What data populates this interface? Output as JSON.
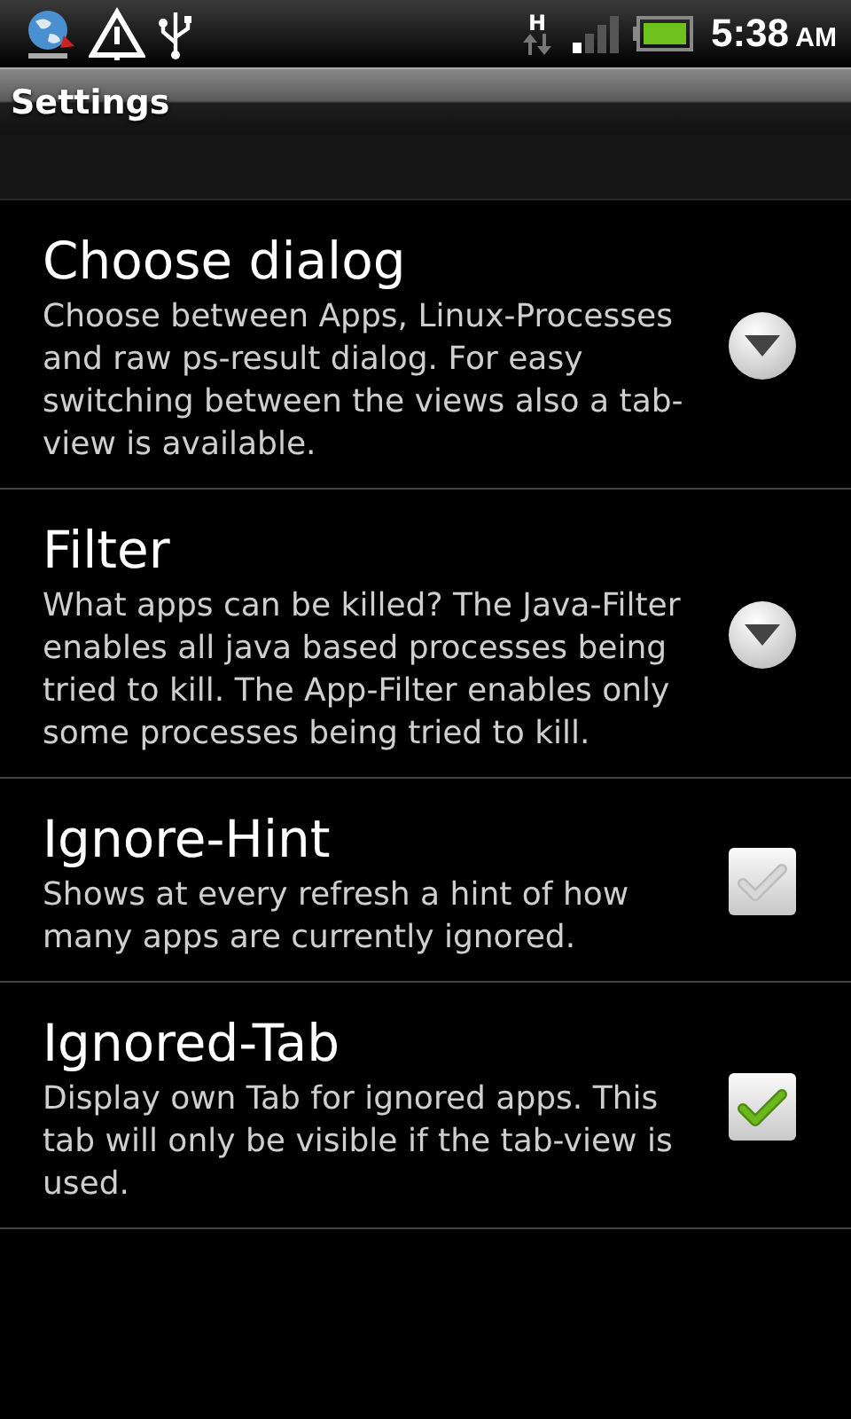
{
  "status_bar": {
    "network_type": "H",
    "time": "5:38",
    "meridiem": "AM"
  },
  "title_bar": {
    "title": "Settings"
  },
  "preferences": [
    {
      "kind": "list",
      "title": "Choose dialog",
      "summary": "Choose between Apps, Linux-Processes and raw ps-result dialog. For easy switching between the views also a tab-view is available."
    },
    {
      "kind": "list",
      "title": "Filter",
      "summary": "What apps can be killed? The Java-Filter enables all java based processes being tried to kill. The App-Filter enables only some processes being tried to kill."
    },
    {
      "kind": "checkbox",
      "title": "Ignore-Hint",
      "summary": "Shows at every refresh a hint of how many apps are currently ignored.",
      "checked": false
    },
    {
      "kind": "checkbox",
      "title": "Ignored-Tab",
      "summary": "Display own Tab for ignored apps. This tab will only be visible if the tab-view is used.",
      "checked": true
    }
  ]
}
